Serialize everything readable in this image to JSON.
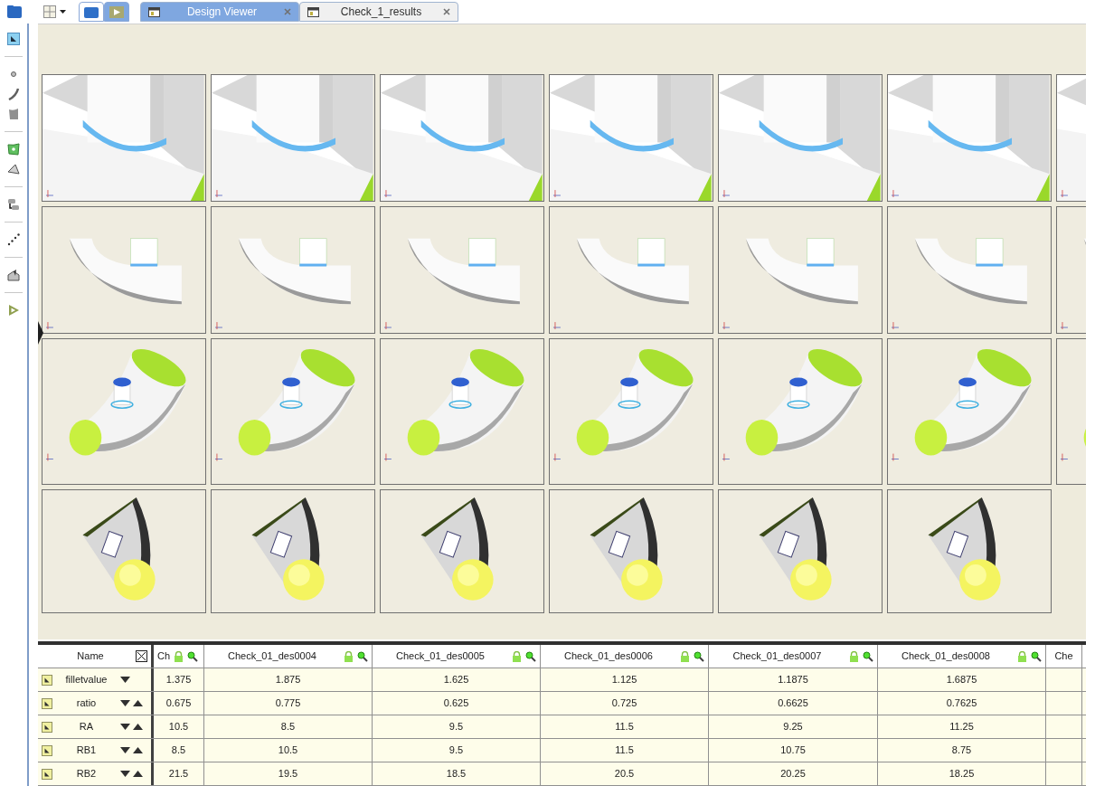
{
  "mode_buttons": [
    {
      "kind": "folder",
      "selected": false
    },
    {
      "kind": "play",
      "selected": true
    }
  ],
  "tabs": [
    {
      "label": "Design Viewer",
      "selected": true
    },
    {
      "label": "Check_1_results",
      "selected": false
    }
  ],
  "viewer": {
    "rows": [
      {
        "kind": "closeup"
      },
      {
        "kind": "side"
      },
      {
        "kind": "iso"
      },
      {
        "kind": "end"
      }
    ]
  },
  "table": {
    "name_header": "Name",
    "columns": [
      {
        "label": "Ch"
      },
      {
        "label": "Check_01_des0004"
      },
      {
        "label": "Check_01_des0005"
      },
      {
        "label": "Check_01_des0006"
      },
      {
        "label": "Check_01_des0007"
      },
      {
        "label": "Check_01_des0008"
      },
      {
        "label": "Che"
      }
    ],
    "rows": [
      {
        "name": "filletvalue",
        "kind": "down",
        "values": [
          "1.375",
          "1.875",
          "1.625",
          "1.125",
          "1.1875",
          "1.6875"
        ]
      },
      {
        "name": "ratio",
        "kind": "updown",
        "values": [
          "0.675",
          "0.775",
          "0.625",
          "0.725",
          "0.6625",
          "0.7625"
        ]
      },
      {
        "name": "RA",
        "kind": "updown",
        "values": [
          "10.5",
          "8.5",
          "9.5",
          "11.5",
          "9.25",
          "11.25"
        ]
      },
      {
        "name": "RB1",
        "kind": "updown",
        "values": [
          "8.5",
          "10.5",
          "9.5",
          "11.5",
          "10.75",
          "8.75"
        ]
      },
      {
        "name": "RB2",
        "kind": "updown",
        "values": [
          "21.5",
          "19.5",
          "18.5",
          "20.5",
          "20.25",
          "18.25"
        ]
      }
    ]
  }
}
